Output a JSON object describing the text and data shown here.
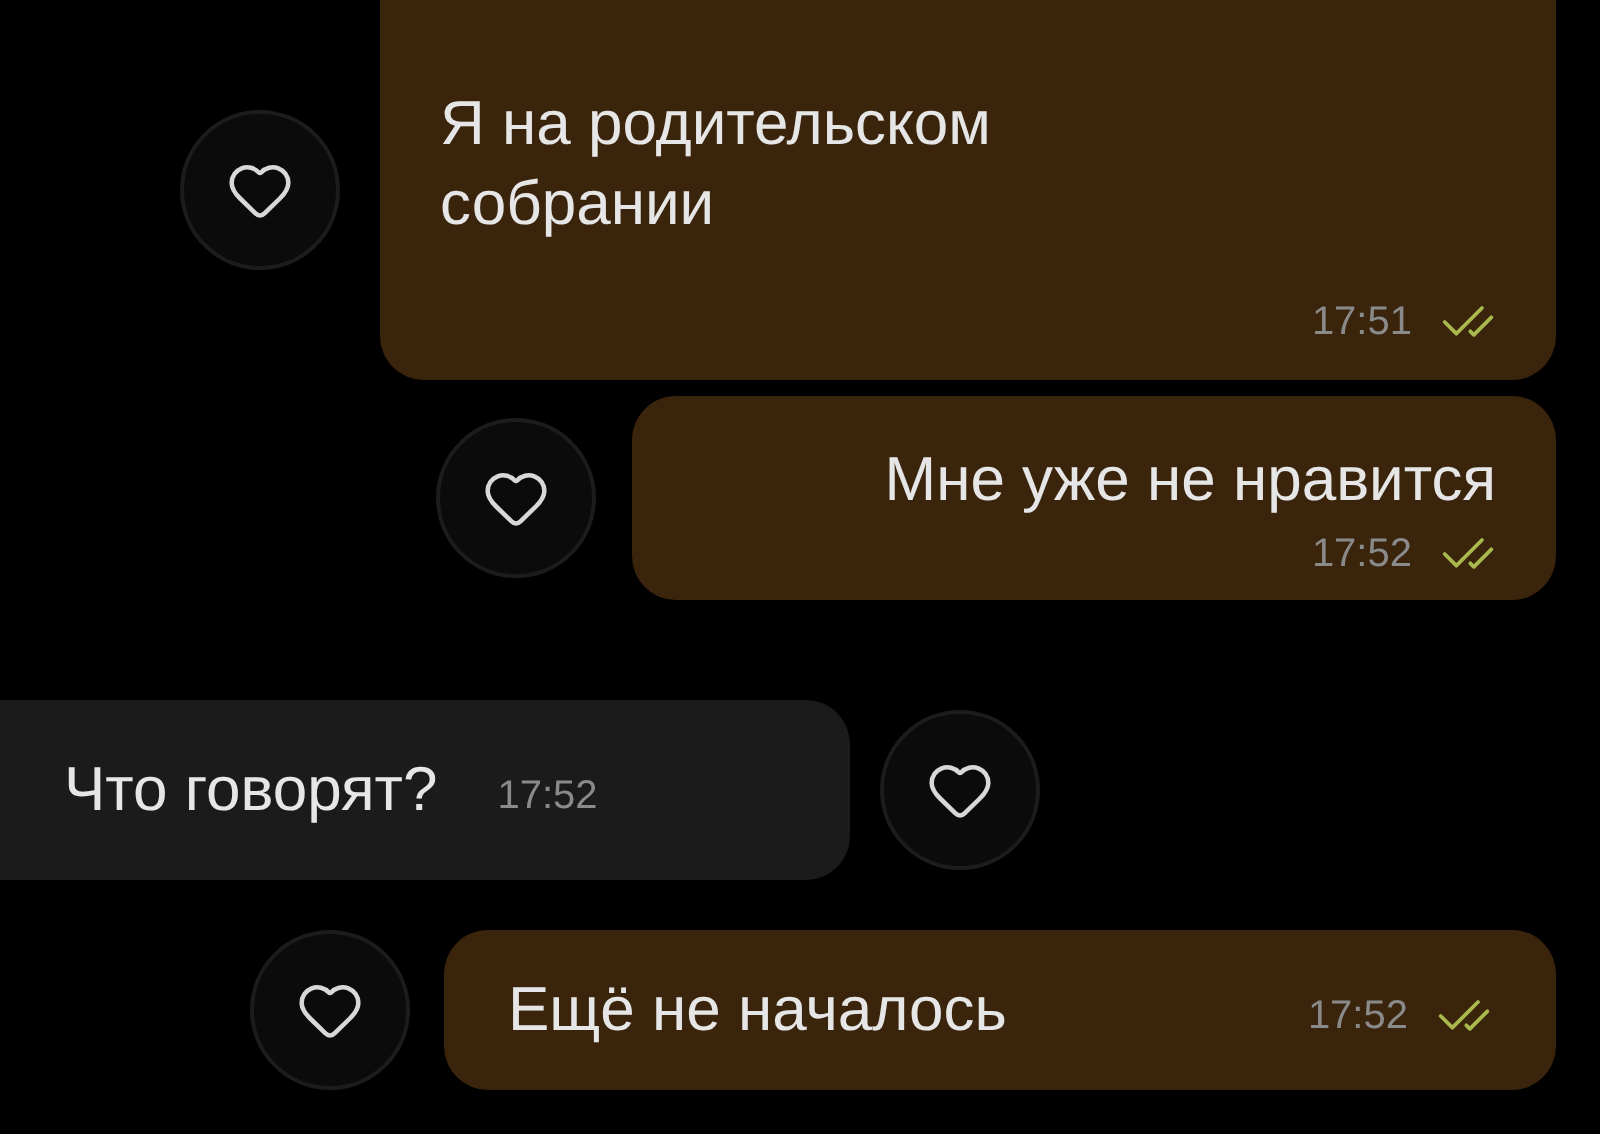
{
  "messages": [
    {
      "kind": "outgoing",
      "lines": [
        "Я на родительском",
        "собрании"
      ],
      "time": "17:51",
      "read": true,
      "liked": false
    },
    {
      "kind": "outgoing",
      "lines": [
        "Мне уже не нравится"
      ],
      "time": "17:52",
      "read": true,
      "liked": false
    },
    {
      "kind": "incoming",
      "lines": [
        "Что говорят?"
      ],
      "time": "17:52",
      "liked": false
    },
    {
      "kind": "outgoing",
      "lines": [
        "Ещё не началось"
      ],
      "time": "17:52",
      "read": true,
      "liked": false
    }
  ]
}
